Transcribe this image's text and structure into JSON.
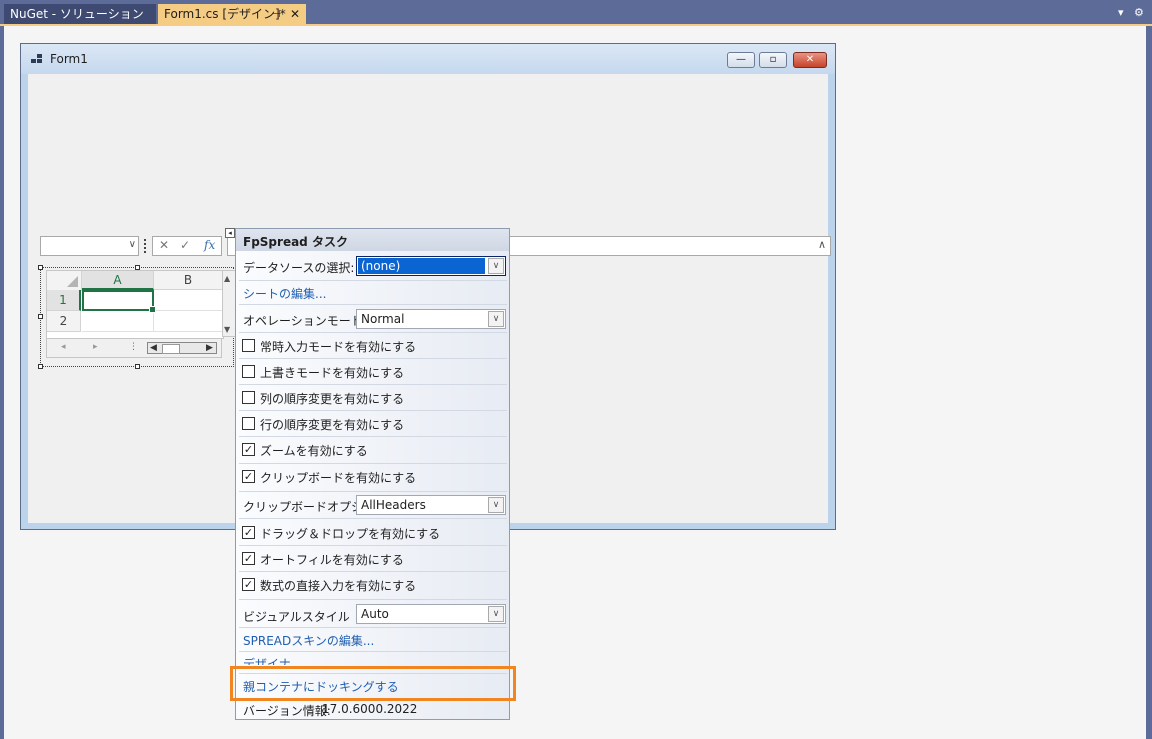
{
  "tabs": {
    "nuget": "NuGet - ソリューション",
    "form": "Form1.cs [デザイン]*",
    "pin": "⊣",
    "close": "✕"
  },
  "strip_icons": {
    "dropdown": "▾",
    "settings": "⚙"
  },
  "form": {
    "title": "Form1",
    "min": "—",
    "max": "▫",
    "close": "✕"
  },
  "formula_bar": {
    "fx": "fx",
    "cancel": "✕",
    "confirm": "✓"
  },
  "sheet": {
    "columns": [
      "A",
      "B"
    ],
    "rows": [
      "1",
      "2"
    ]
  },
  "task_panel": {
    "title": "FpSpread タスク",
    "datasource_label": "データソースの選択:",
    "datasource_value": "(none)",
    "edit_sheets": "シートの編集...",
    "operation_label": "オペレーションモード",
    "operation_value": "Normal",
    "checks": [
      {
        "label": "常時入力モードを有効にする",
        "checked": false
      },
      {
        "label": "上書きモードを有効にする",
        "checked": false
      },
      {
        "label": "列の順序変更を有効にする",
        "checked": false
      },
      {
        "label": "行の順序変更を有効にする",
        "checked": false
      },
      {
        "label": "ズームを有効にする",
        "checked": true
      },
      {
        "label": "クリップボードを有効にする",
        "checked": true
      }
    ],
    "clipboard_label": "クリップボードオプション",
    "clipboard_value": "AllHeaders",
    "checks2": [
      {
        "label": "ドラッグ＆ドロップを有効にする",
        "checked": true
      },
      {
        "label": "オートフィルを有効にする",
        "checked": true
      },
      {
        "label": "数式の直接入力を有効にする",
        "checked": true
      }
    ],
    "visual_label": "ビジュアルスタイル",
    "visual_value": "Auto",
    "edit_skin": "SPREADスキンの編集...",
    "designer": "デザイナ",
    "dock": "親コンテナにドッキングする",
    "version_label": "バージョン情報:",
    "version_value": "17.0.6000.2022"
  }
}
